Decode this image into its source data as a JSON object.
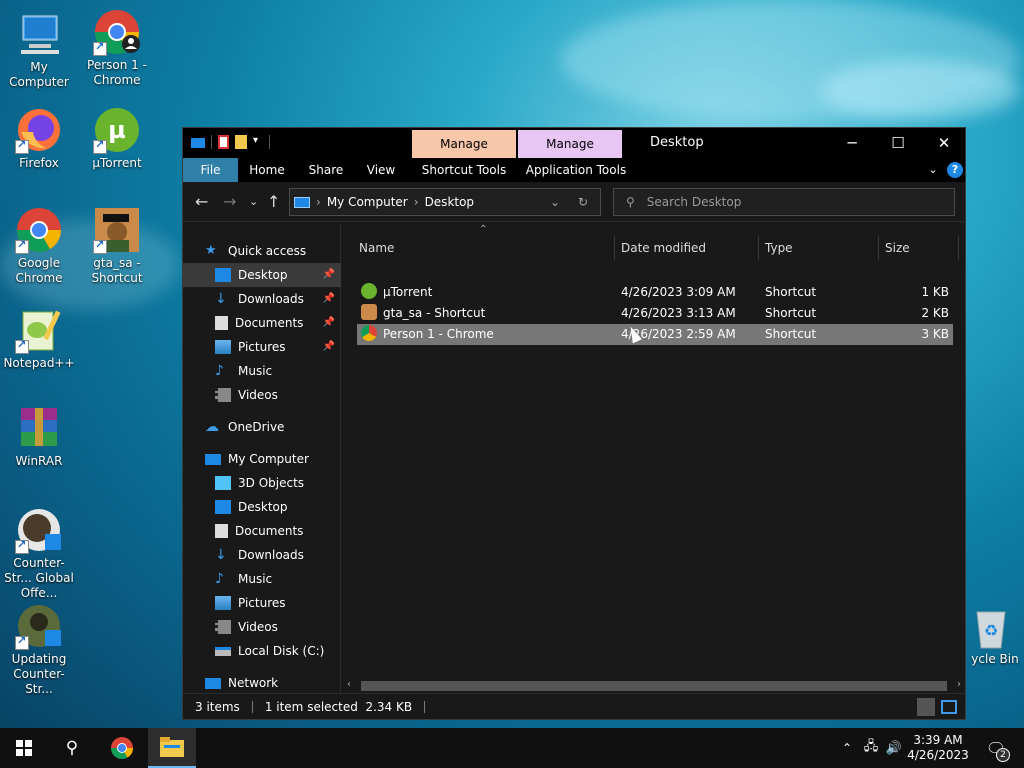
{
  "desktop": {
    "icons": [
      {
        "label": "My Computer"
      },
      {
        "label": "Person 1 - Chrome"
      },
      {
        "label": "Firefox"
      },
      {
        "label": "µTorrent"
      },
      {
        "label": "Google Chrome"
      },
      {
        "label": "gta_sa - Shortcut"
      },
      {
        "label": "Notepad++"
      },
      {
        "label": "WinRAR"
      },
      {
        "label": "Counter-Str... Global Offe..."
      },
      {
        "label": "Updating Counter-Str..."
      },
      {
        "label": "ycle Bin"
      }
    ]
  },
  "window": {
    "title": "Desktop",
    "context_tabs": [
      {
        "label": "Manage",
        "color": "#f8c6a8"
      },
      {
        "label": "Manage",
        "color": "#e8c6f4"
      }
    ],
    "ribbon_tabs": [
      "File",
      "Home",
      "Share",
      "View",
      "Shortcut Tools",
      "Application Tools"
    ],
    "address": {
      "root": "My Computer",
      "current": "Desktop"
    },
    "search": {
      "placeholder": "Search Desktop"
    },
    "sidebar": [
      {
        "label": "Quick access",
        "icon": "star-icon",
        "pinned": false
      },
      {
        "label": "Desktop",
        "icon": "desktop-icon",
        "pinned": true,
        "selected": true
      },
      {
        "label": "Downloads",
        "icon": "download-icon",
        "pinned": true
      },
      {
        "label": "Documents",
        "icon": "documents-icon",
        "pinned": true
      },
      {
        "label": "Pictures",
        "icon": "pictures-icon",
        "pinned": true
      },
      {
        "label": "Music",
        "icon": "music-icon",
        "pinned": false
      },
      {
        "label": "Videos",
        "icon": "videos-icon",
        "pinned": false
      },
      {
        "label": "OneDrive",
        "icon": "cloud-icon",
        "pinned": false
      },
      {
        "label": "My Computer",
        "icon": "computer-icon",
        "pinned": false
      },
      {
        "label": "3D Objects",
        "icon": "cube-icon",
        "pinned": false
      },
      {
        "label": "Desktop",
        "icon": "desktop-icon",
        "pinned": false
      },
      {
        "label": "Documents",
        "icon": "documents-icon",
        "pinned": false
      },
      {
        "label": "Downloads",
        "icon": "download-icon",
        "pinned": false
      },
      {
        "label": "Music",
        "icon": "music-icon",
        "pinned": false
      },
      {
        "label": "Pictures",
        "icon": "pictures-icon",
        "pinned": false
      },
      {
        "label": "Videos",
        "icon": "videos-icon",
        "pinned": false
      },
      {
        "label": "Local Disk (C:)",
        "icon": "drive-icon",
        "pinned": false
      },
      {
        "label": "Network",
        "icon": "network-icon",
        "pinned": false
      }
    ],
    "columns": [
      "Name",
      "Date modified",
      "Type",
      "Size"
    ],
    "files": [
      {
        "name": "µTorrent",
        "date": "4/26/2023 3:09 AM",
        "type": "Shortcut",
        "size": "1 KB",
        "icon": "utorrent-icon"
      },
      {
        "name": "gta_sa - Shortcut",
        "date": "4/26/2023 3:13 AM",
        "type": "Shortcut",
        "size": "2 KB",
        "icon": "gta-icon"
      },
      {
        "name": "Person 1 - Chrome",
        "date": "4/26/2023 2:59 AM",
        "type": "Shortcut",
        "size": "3 KB",
        "icon": "chrome-icon",
        "selected": true
      }
    ],
    "status": {
      "items": "3 items",
      "selection": "1 item selected  2.34 KB"
    }
  },
  "taskbar": {
    "time": "3:39 AM",
    "date": "4/26/2023",
    "notifications": "2"
  }
}
